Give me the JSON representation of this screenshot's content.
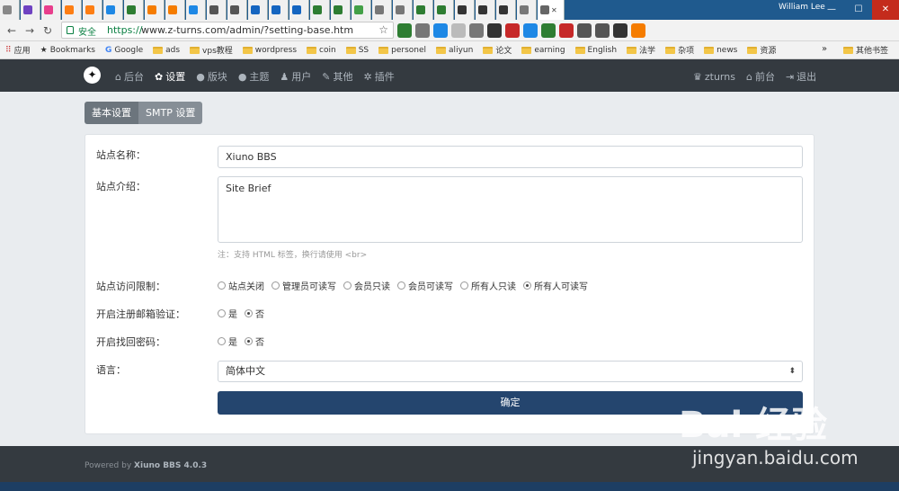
{
  "browser": {
    "user": "William Lee",
    "address": {
      "secure_label": "安全",
      "url_https": "https://",
      "url_rest": "www.z-turns.com/admin/?setting-base.htm"
    },
    "bookmarks": [
      {
        "label": "应用",
        "icon": "apps-icon"
      },
      {
        "label": "Bookmarks",
        "icon": "star-icon"
      },
      {
        "label": "Google",
        "icon": "google-icon"
      },
      {
        "label": "ads",
        "icon": "folder-icon"
      },
      {
        "label": "vps教程",
        "icon": "folder-icon"
      },
      {
        "label": "wordpress",
        "icon": "folder-icon"
      },
      {
        "label": "coin",
        "icon": "folder-icon"
      },
      {
        "label": "SS",
        "icon": "folder-icon"
      },
      {
        "label": "personel",
        "icon": "folder-icon"
      },
      {
        "label": "aliyun",
        "icon": "folder-icon"
      },
      {
        "label": "论文",
        "icon": "folder-icon"
      },
      {
        "label": "earning",
        "icon": "folder-icon"
      },
      {
        "label": "English",
        "icon": "folder-icon"
      },
      {
        "label": "法学",
        "icon": "folder-icon"
      },
      {
        "label": "杂项",
        "icon": "folder-icon"
      },
      {
        "label": "news",
        "icon": "folder-icon"
      },
      {
        "label": "资源",
        "icon": "folder-icon"
      }
    ],
    "more": "»",
    "other_bookmarks": "其他书签"
  },
  "nav": {
    "left": [
      {
        "label": "后台",
        "icon": "home-icon",
        "active": false
      },
      {
        "label": "设置",
        "icon": "gear-icon",
        "active": true
      },
      {
        "label": "版块",
        "icon": "comment-icon",
        "active": false
      },
      {
        "label": "主题",
        "icon": "comments-icon",
        "active": false
      },
      {
        "label": "用户",
        "icon": "user-icon",
        "active": false
      },
      {
        "label": "其他",
        "icon": "wrench-icon",
        "active": false
      },
      {
        "label": "插件",
        "icon": "cogs-icon",
        "active": false
      }
    ],
    "right": [
      {
        "label": "zturns",
        "icon": "avatar-icon"
      },
      {
        "label": "前台",
        "icon": "home-icon"
      },
      {
        "label": "退出",
        "icon": "sign-out-icon"
      }
    ]
  },
  "settings_tabs": [
    "基本设置",
    "SMTP 设置"
  ],
  "form": {
    "site_name_label": "站点名称：",
    "site_name_value": "Xiuno BBS",
    "site_brief_label": "站点介绍：",
    "site_brief_value": "Site Brief",
    "brief_hint": "注：支持 HTML 标签，换行请使用 <br>",
    "access_label": "站点访问限制：",
    "access_options": [
      {
        "label": "站点关闭",
        "checked": false
      },
      {
        "label": "管理员可读写",
        "checked": false
      },
      {
        "label": "会员只读",
        "checked": false
      },
      {
        "label": "会员可读写",
        "checked": false
      },
      {
        "label": "所有人只读",
        "checked": false
      },
      {
        "label": "所有人可读写",
        "checked": true
      }
    ],
    "email_verify_label": "开启注册邮箱验证：",
    "email_verify_options": [
      {
        "label": "是",
        "checked": false
      },
      {
        "label": "否",
        "checked": true
      }
    ],
    "reset_pw_label": "开启找回密码：",
    "reset_pw_options": [
      {
        "label": "是",
        "checked": false
      },
      {
        "label": "否",
        "checked": true
      }
    ],
    "language_label": "语言：",
    "language_value": "简体中文",
    "submit_label": "确定"
  },
  "footer": {
    "powered_prefix": "Powered by",
    "powered_name": "Xiuno BBS 4.0.3"
  },
  "watermark": {
    "main": "Bai 经验",
    "sub": "jingyan.baidu.com"
  }
}
